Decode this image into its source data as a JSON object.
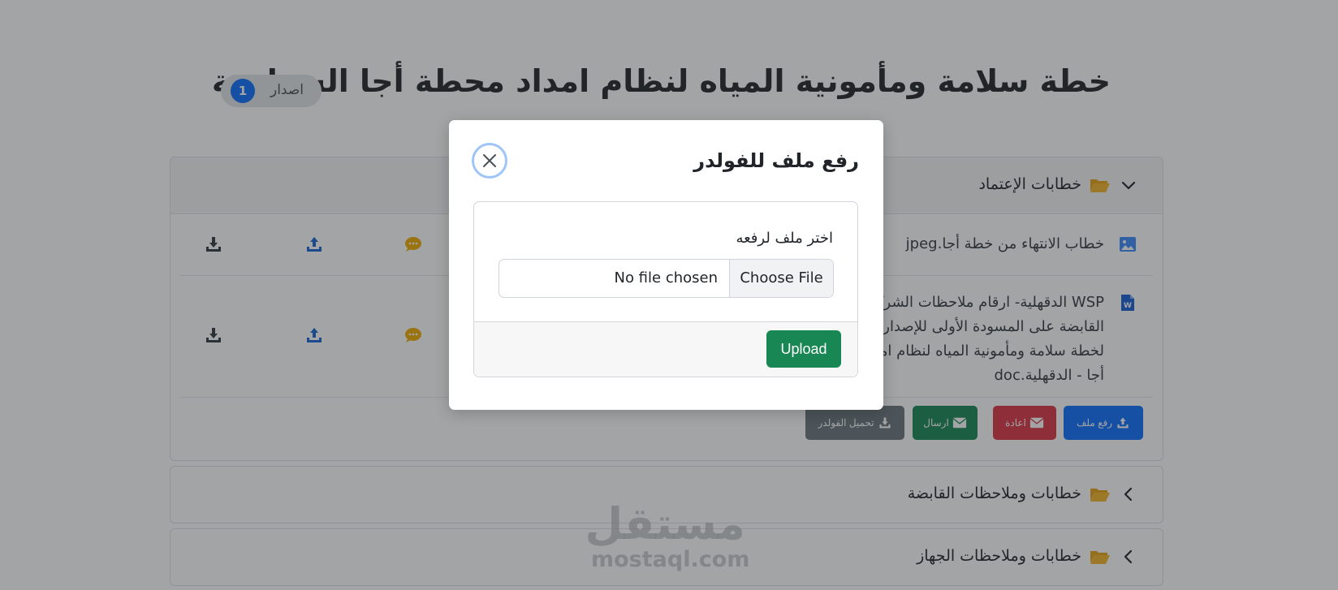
{
  "page": {
    "title": "خطة سلامة ومأمونية المياه لنظام امداد محطة أجا السطحية",
    "version_label": "اصدار",
    "version_number": "1"
  },
  "accordion": [
    {
      "title": "خطابات الإعتماد",
      "expanded": true,
      "files": [
        {
          "name": "خطاب الانتهاء من خطة أجا.jpeg",
          "type": "image"
        },
        {
          "name": "WSP الدقهلية- ارقام ملاحظات الشركة القابضة على المسودة الأولى للإصدار الأول لخطة سلامة ومأمونية المياه لنظام امداد أجا - الدقهلية.doc",
          "type": "word"
        }
      ],
      "buttons": {
        "upload": "رفع ملف",
        "return": "اعادة",
        "send": "ارسال",
        "download_folder": "تحميل الفولدر"
      }
    },
    {
      "title": "خطابات وملاحظات القابضة",
      "expanded": false
    },
    {
      "title": "خطابات وملاحظات الجهاز",
      "expanded": false
    }
  ],
  "modal": {
    "title": "رفع ملف للفولدر",
    "label": "اختر ملف لرفعه",
    "choose_button": "Choose File",
    "no_file_text": "No file chosen",
    "upload_button": "Upload"
  },
  "watermark": {
    "arabic": "مستقل",
    "latin": "mostaql.com"
  },
  "colors": {
    "primary": "#0d6efd",
    "danger": "#dc3545",
    "success": "#198754",
    "secondary": "#6c757d",
    "folder": "#e8a317",
    "comment": "#f0ad00",
    "backdrop": "rgba(33,37,41,0.42)"
  },
  "icons": {
    "folder": "folder-open-icon",
    "chevron_expanded": "chevron-down-icon",
    "chevron_collapsed": "chevron-left-icon",
    "image_file": "image-file-icon",
    "word_file": "word-file-icon",
    "download": "download-icon",
    "upload": "upload-icon",
    "comment": "comment-icon",
    "envelope": "envelope-icon",
    "close": "close-icon"
  }
}
